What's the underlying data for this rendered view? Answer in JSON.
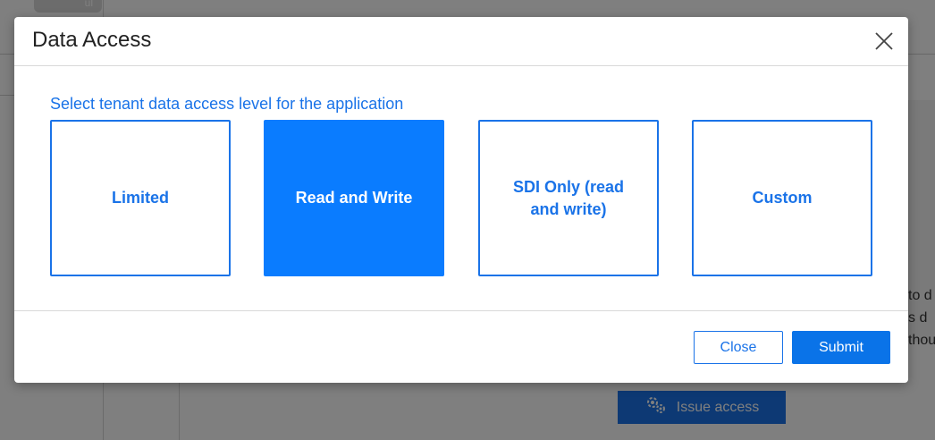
{
  "background": {
    "top_button_label": "ul",
    "right_text_lines": [
      "to d",
      "s d",
      "thou"
    ],
    "issue_button_label": "Issue access",
    "issue_icon": "gears-icon"
  },
  "modal": {
    "title": "Data Access",
    "close_icon": "close-icon",
    "prompt": "Select tenant data access level for the application",
    "options": [
      {
        "label": "Limited",
        "selected": false
      },
      {
        "label": "Read and Write",
        "selected": true
      },
      {
        "label": "SDI Only (read and write)",
        "selected": false
      },
      {
        "label": "Custom",
        "selected": false
      }
    ],
    "buttons": {
      "close_label": "Close",
      "submit_label": "Submit"
    }
  },
  "colors": {
    "accent": "#1a73e8",
    "selected_fill": "#0a7cff",
    "overlay": "rgba(0,0,0,0.5)"
  }
}
